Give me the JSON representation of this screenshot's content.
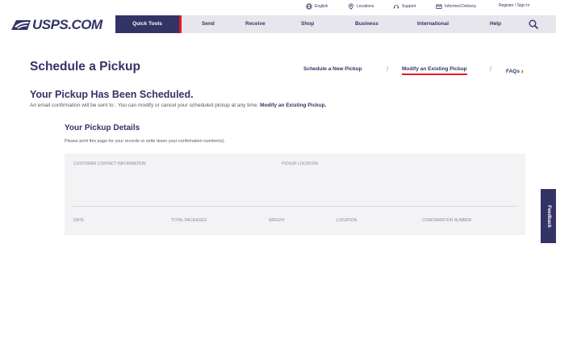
{
  "utility_bar": {
    "language": "English",
    "locations": "Locations",
    "support": "Support",
    "informed_delivery": "Informed Delivery",
    "register": "Register / Sign In"
  },
  "logo": {
    "text": "USPS.COM"
  },
  "nav": {
    "quick_tools": "Quick Tools",
    "send": "Send",
    "receive": "Receive",
    "shop": "Shop",
    "business": "Business",
    "international": "International",
    "help": "Help"
  },
  "page": {
    "title": "Schedule a Pickup",
    "subnav": {
      "new_pickup": "Schedule a New Pickup",
      "modify_pickup": "Modify an Existing Pickup",
      "faqs": "FAQs",
      "separator": "/"
    }
  },
  "confirmation": {
    "heading": "Your Pickup Has Been Scheduled.",
    "text": "An email confirmation will be sent to . You can modify or cancel your scheduled pickup at any time.",
    "link": "Modify an Existing Pickup."
  },
  "details": {
    "heading": "Your Pickup Details",
    "note": "Please print this page for your records or write down your confirmation number(s).",
    "labels": {
      "customer_contact": "Customer Contact Information",
      "pickup_location": "Pickup Location",
      "date": "Date",
      "total_packages": "Total Packages",
      "weight": "Weight",
      "location": "Location",
      "confirmation_number": "Confirmation Number"
    }
  },
  "feedback": {
    "label": "Feedback"
  },
  "colors": {
    "brand_navy": "#333366",
    "accent_red": "#e71921",
    "panel_gray": "#f3f3f5"
  }
}
